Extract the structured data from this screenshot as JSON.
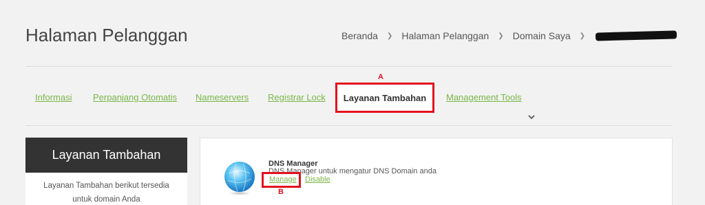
{
  "header": {
    "title": "Halaman Pelanggan",
    "breadcrumb": [
      "Beranda",
      "Halaman Pelanggan",
      "Domain Saya"
    ]
  },
  "tabs": [
    {
      "label": "Informasi"
    },
    {
      "label": "Perpanjang Otomatis"
    },
    {
      "label": "Nameservers"
    },
    {
      "label": "Registrar Lock"
    },
    {
      "label": "Layanan Tambahan",
      "active": true
    },
    {
      "label": "Management Tools"
    }
  ],
  "annotations": {
    "a": "A",
    "b": "B"
  },
  "sidebar": {
    "title": "Layanan Tambahan",
    "text": "Layanan Tambahan berikut tersedia untuk domain Anda"
  },
  "service": {
    "title": "DNS Manager",
    "description": "DNS Manager untuk mengatur DNS Domain anda",
    "manage_label": "Manage",
    "disable_label": "Disable",
    "icon": "globe-icon"
  },
  "colors": {
    "accent_green": "#7ab648",
    "highlight_red": "#e3101d",
    "sidebar_dark": "#333333"
  }
}
